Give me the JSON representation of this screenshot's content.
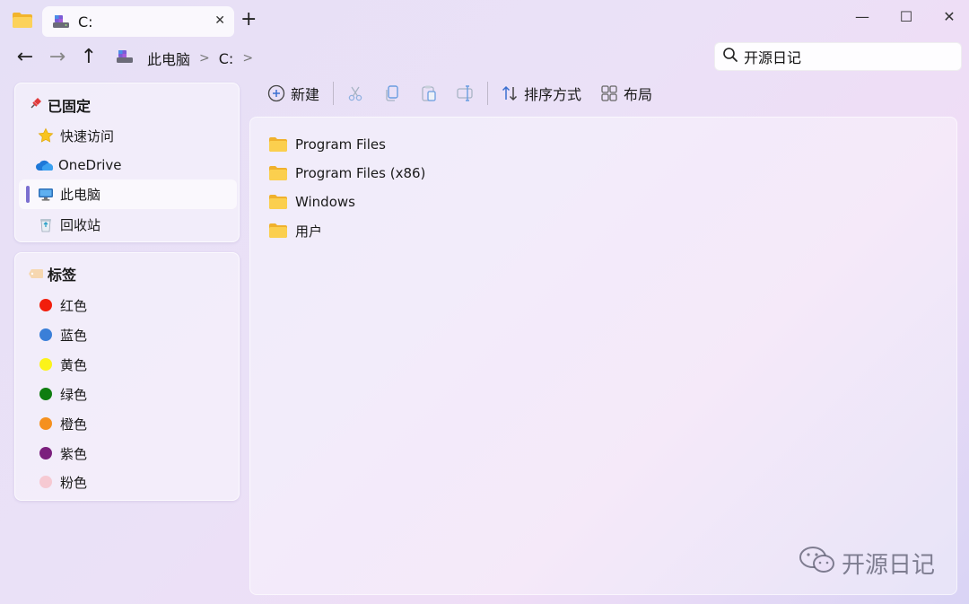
{
  "tab": {
    "title": "C:",
    "close": "✕",
    "new": "+"
  },
  "window_controls": {
    "minimize": "—",
    "maximize": "☐",
    "close": "✕"
  },
  "nav": {
    "back": "←",
    "forward": "→",
    "up": "↑"
  },
  "breadcrumb": {
    "root": "此电脑",
    "current": "C:",
    "sep1": ">",
    "sep2": ">"
  },
  "search": {
    "value": "开源日记"
  },
  "sidebar": {
    "pinned_title": "已固定",
    "pinned": [
      {
        "label": "快速访问",
        "icon": "star-icon"
      },
      {
        "label": "OneDrive",
        "icon": "cloud-icon"
      },
      {
        "label": "此电脑",
        "icon": "computer-icon"
      },
      {
        "label": "回收站",
        "icon": "recycle-bin-icon"
      }
    ],
    "tags_title": "标签",
    "tags": [
      {
        "label": "红色",
        "color": "#f21e0c"
      },
      {
        "label": "蓝色",
        "color": "#3a7fd8"
      },
      {
        "label": "黄色",
        "color": "#fbf31a"
      },
      {
        "label": "绿色",
        "color": "#0f7d10"
      },
      {
        "label": "橙色",
        "color": "#f5901e"
      },
      {
        "label": "紫色",
        "color": "#7b1f7d"
      },
      {
        "label": "粉色",
        "color": "#f6c9d2"
      }
    ]
  },
  "toolbar": {
    "new": "新建",
    "sort": "排序方式",
    "layout": "布局"
  },
  "files": [
    {
      "name": "Program Files"
    },
    {
      "name": "Program Files (x86)"
    },
    {
      "name": "Windows"
    },
    {
      "name": "用户"
    }
  ],
  "watermark": "开源日记",
  "colors": {
    "accent": "#7b6fd0",
    "folder": "#f5c23e"
  }
}
